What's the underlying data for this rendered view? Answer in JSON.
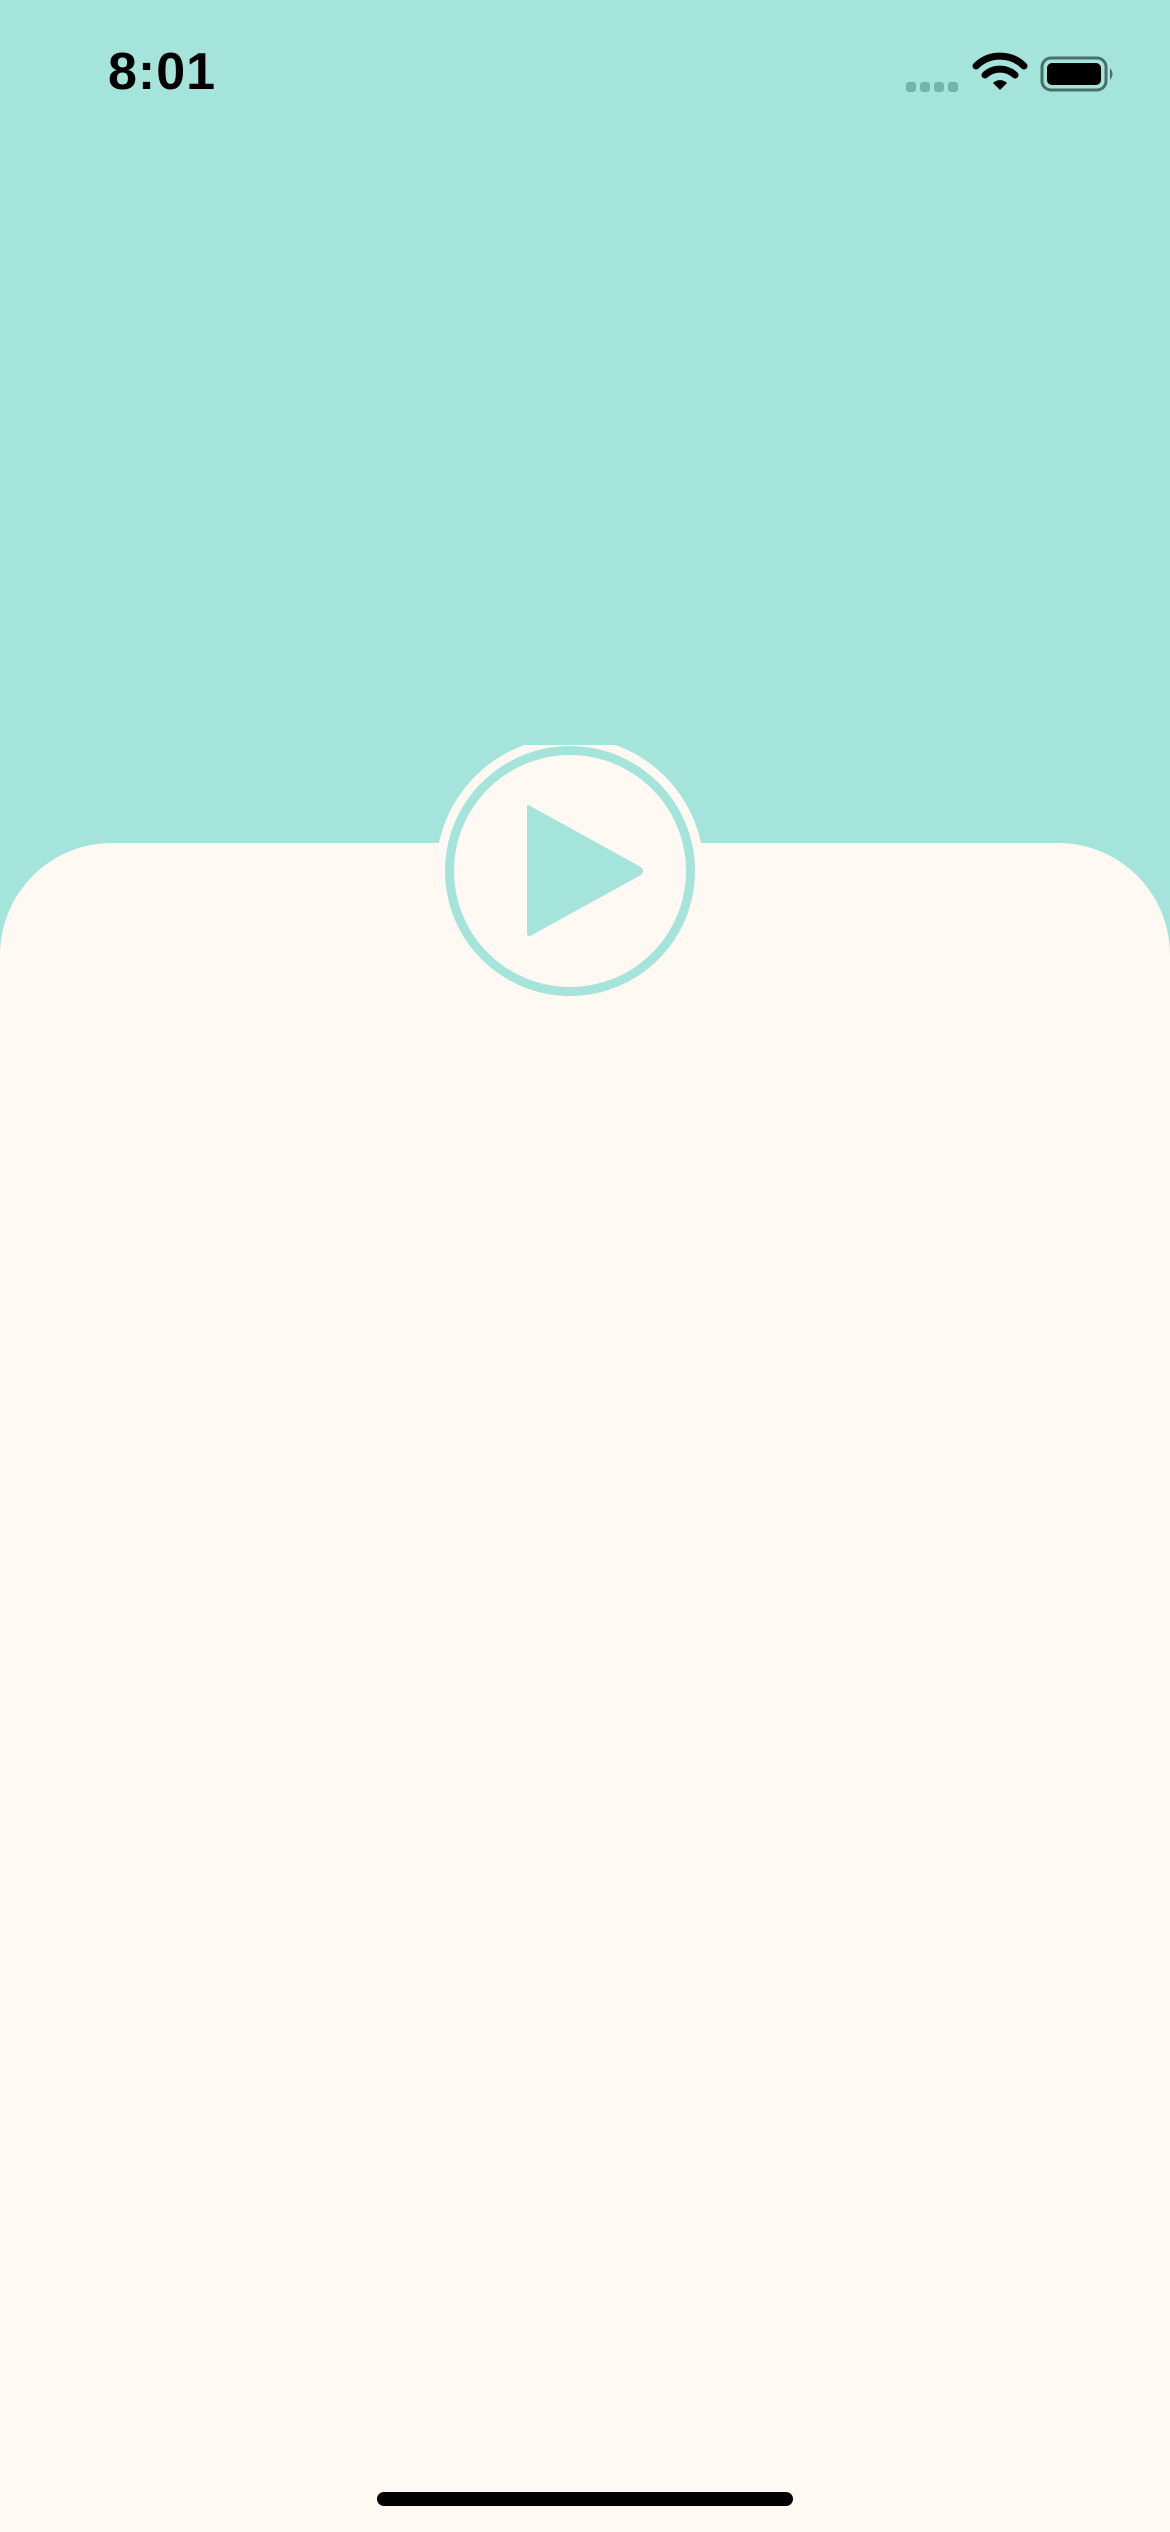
{
  "status_bar": {
    "time": "8:01",
    "icons": [
      "cellular-signal-icon",
      "wifi-icon",
      "battery-icon"
    ]
  },
  "player": {
    "play_icon": "play-icon"
  },
  "colors": {
    "background_top": "#a5e4da",
    "sheet_background": "#fff8f3",
    "accent": "#a5e4da",
    "status_text": "#000000"
  }
}
